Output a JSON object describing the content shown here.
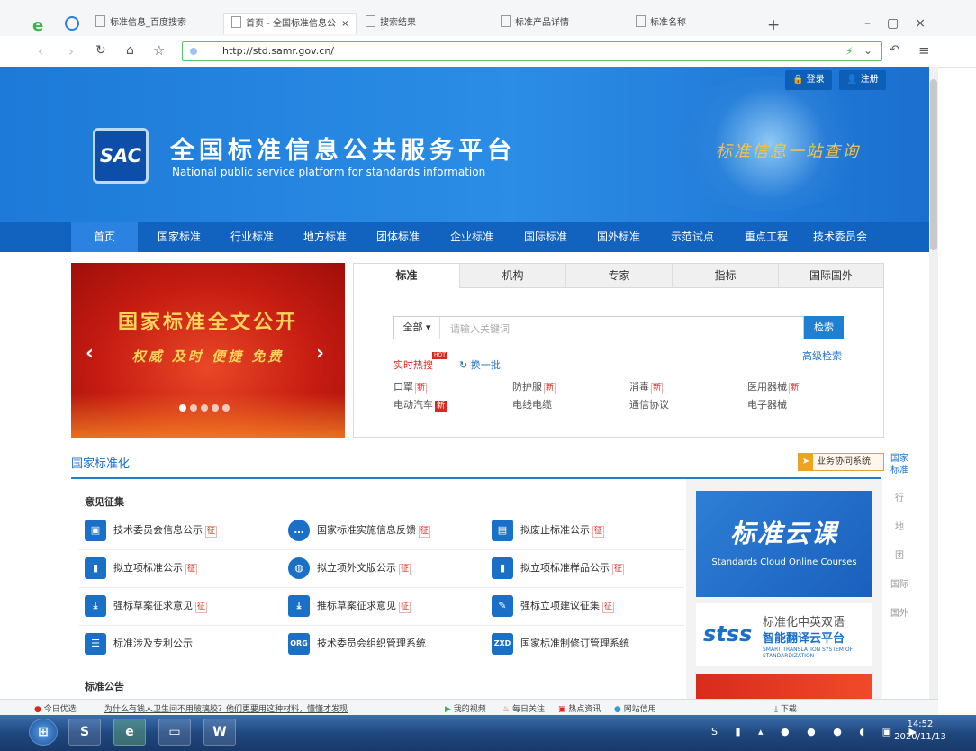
{
  "browser": {
    "tabs": [
      {
        "label": "标准信息_百度搜索"
      },
      {
        "label": "首页 - 全国标准信息公"
      },
      {
        "label": "搜索结果"
      },
      {
        "label": "标准产品详情"
      },
      {
        "label": "标准名称"
      }
    ],
    "url": "http://std.samr.gov.cn/"
  },
  "header": {
    "login": "登录",
    "register": "注册",
    "logo_text": "SAC",
    "title_cn": "全国标准信息公共服务平台",
    "title_en": "National public service platform  for standards information",
    "slogan": "标准信息一站查询"
  },
  "nav": [
    "首页",
    "国家标准",
    "行业标准",
    "地方标准",
    "团体标准",
    "企业标准",
    "国际标准",
    "国外标准",
    "示范试点",
    "重点工程",
    "技术委员会"
  ],
  "banner": {
    "line1": "国家标准全文公开",
    "line2": "权威 及时 便捷 免费"
  },
  "search": {
    "tabs": [
      "标准",
      "机构",
      "专家",
      "指标",
      "国际国外"
    ],
    "select": "全部",
    "placeholder": "请输入关键词",
    "button": "检索",
    "advanced": "高级检索",
    "hot_label": "实时热搜",
    "hot_badge": "HOT",
    "refresh": "换一批",
    "keywords": [
      "口罩",
      "防护服",
      "消毒",
      "医用器械",
      "电动汽车",
      "电线电缆",
      "通信协议",
      "电子器械"
    ],
    "new_tag": "新"
  },
  "section": {
    "title": "国家标准化",
    "business_button": "业务协同系统",
    "side_nav": [
      "国家标准",
      "行",
      "地",
      "团",
      "国际",
      "国外"
    ],
    "group1": "意见征集",
    "group2": "标准公告",
    "zheng_tag": "征",
    "items": [
      "技术委员会信息公示",
      "国家标准实施信息反馈",
      "拟废止标准公示",
      "拟立项标准公示",
      "拟立项外文版公示",
      "拟立项标准样品公示",
      "强标草案征求意见",
      "推标草案征求意见",
      "强标立项建议征集",
      "标准涉及专利公示",
      "技术委员会组织管理系统",
      "国家标准制修订管理系统"
    ]
  },
  "cards": {
    "card1_title": "标准云课",
    "card1_sub": "Standards Cloud Online Courses",
    "card2_logo": "stss",
    "card2_line1": "标准化中英双语",
    "card2_line2": "智能翻译云平台",
    "card2_line3": "SMART TRANSLATION SYSTEM OF STANDARDIZATION"
  },
  "statusbar": {
    "left": "今日优选",
    "news": "为什么有钱人卫生间不用玻璃胶？他们更要用这种材料，懂懂才发现",
    "items": [
      "我的视频",
      "每日关注",
      "热点资讯",
      "网站信用",
      "下载"
    ]
  },
  "taskbar": {
    "time": "14:52",
    "date": "2020/11/13"
  }
}
